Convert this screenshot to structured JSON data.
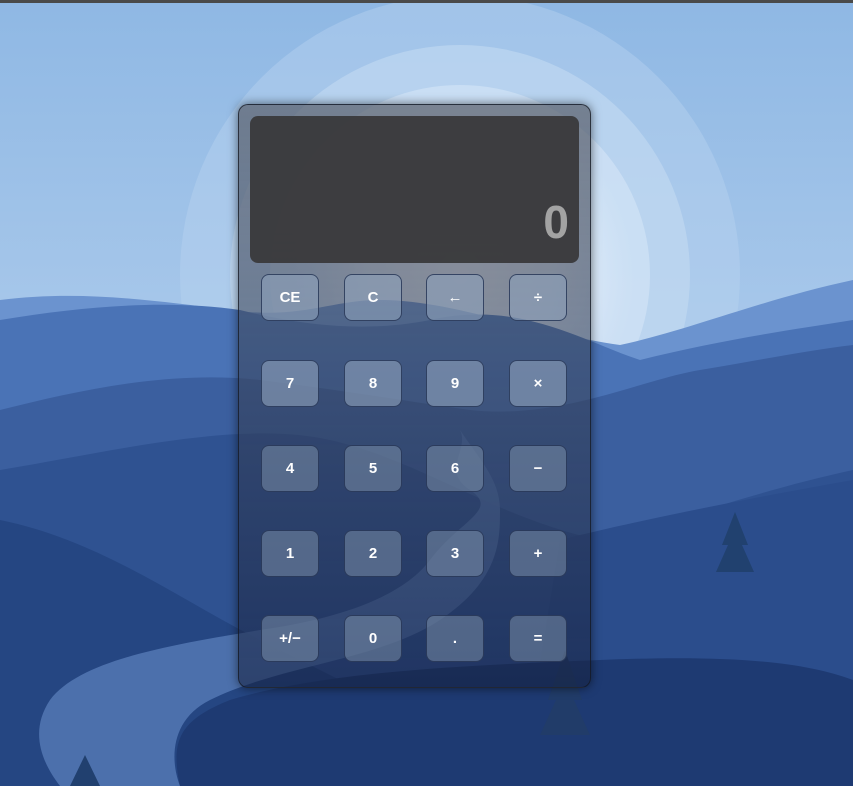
{
  "display": {
    "value": "0"
  },
  "keys": {
    "row1": [
      "CE",
      "C",
      "←",
      "÷"
    ],
    "row2": [
      "7",
      "8",
      "9",
      "×"
    ],
    "row3": [
      "4",
      "5",
      "6",
      "−"
    ],
    "row4": [
      "1",
      "2",
      "3",
      "+"
    ],
    "row5": [
      "+/−",
      "0",
      ".",
      "="
    ]
  }
}
